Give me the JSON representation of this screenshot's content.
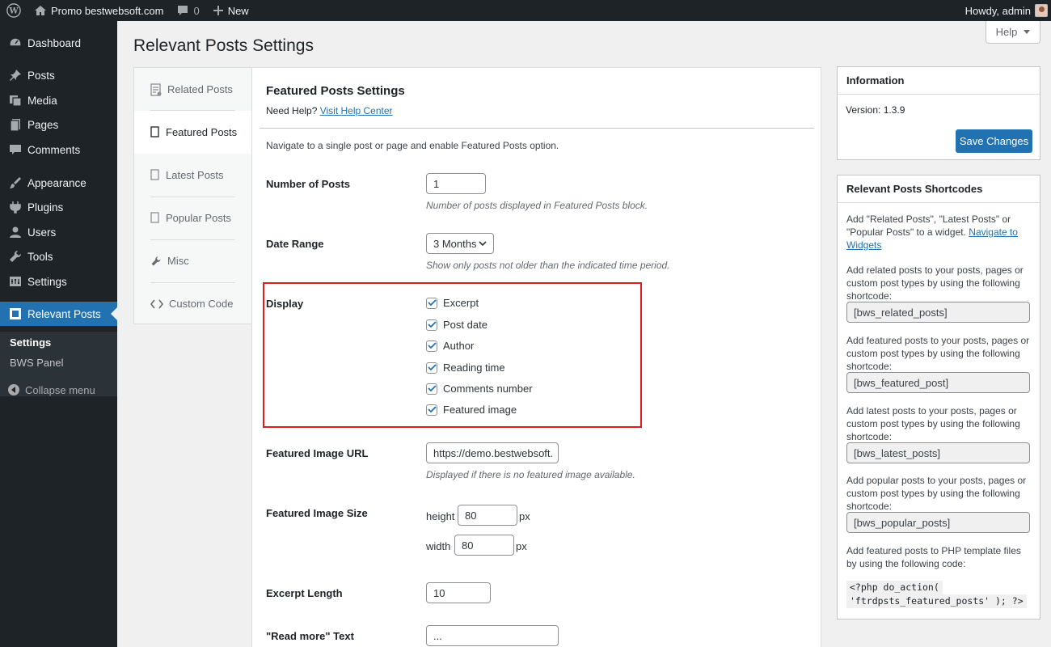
{
  "adminbar": {
    "site": "Promo bestwebsoft.com",
    "comments_count": "0",
    "new_label": "New",
    "howdy": "Howdy, admin"
  },
  "menu": {
    "items": [
      {
        "label": "Dashboard",
        "icon": "dashboard-icon"
      },
      {
        "label": "Posts",
        "icon": "pin-icon"
      },
      {
        "label": "Media",
        "icon": "media-icon"
      },
      {
        "label": "Pages",
        "icon": "pages-icon"
      },
      {
        "label": "Comments",
        "icon": "comments-icon"
      },
      {
        "label": "Appearance",
        "icon": "brush-icon"
      },
      {
        "label": "Plugins",
        "icon": "plugins-icon"
      },
      {
        "label": "Users",
        "icon": "users-icon"
      },
      {
        "label": "Tools",
        "icon": "wrench-icon"
      },
      {
        "label": "Settings",
        "icon": "settings-icon"
      },
      {
        "label": "Relevant Posts",
        "icon": "relevant-posts-icon"
      }
    ],
    "submenu": [
      "Settings",
      "BWS Panel"
    ],
    "collapse": "Collapse menu"
  },
  "help_label": "Help",
  "page_title": "Relevant Posts Settings",
  "tabs": [
    "Related Posts",
    "Featured Posts",
    "Latest Posts",
    "Popular Posts",
    "Misc",
    "Custom Code"
  ],
  "panel": {
    "title": "Featured Posts Settings",
    "need_help": "Need Help?",
    "help_link": "Visit Help Center",
    "intro": "Navigate to a single post or page and enable Featured Posts option.",
    "number_label": "Number of Posts",
    "number_value": "1",
    "number_desc": "Number of posts displayed in Featured Posts block.",
    "date_label": "Date Range",
    "date_value": "3 Months",
    "date_desc": "Show only posts not older than the indicated time period.",
    "display_label": "Display",
    "display_options": [
      "Excerpt",
      "Post date",
      "Author",
      "Reading time",
      "Comments number",
      "Featured image"
    ],
    "image_url_label": "Featured Image URL",
    "image_url_value": "https://demo.bestwebsoft.",
    "image_url_desc": "Displayed if there is no featured image available.",
    "image_size_label": "Featured Image Size",
    "height_label": "height",
    "height_value": "80",
    "width_label": "width",
    "width_value": "80",
    "px": "px",
    "excerpt_label": "Excerpt Length",
    "excerpt_value": "10",
    "readmore_label": "\"Read more\" Text",
    "readmore_value": "..."
  },
  "info": {
    "title": "Information",
    "version": "Version: 1.3.9",
    "save": "Save Changes"
  },
  "shortcodes": {
    "title": "Relevant Posts Shortcodes",
    "widget_text": "Add \"Related Posts\", \"Latest Posts\" or \"Popular Posts\" to a widget.",
    "widget_link": "Navigate to Widgets",
    "related_text": "Add related posts to your posts, pages or custom post types by using the following shortcode:",
    "related_code": "[bws_related_posts]",
    "featured_text": "Add featured posts to your posts, pages or custom post types by using the following shortcode:",
    "featured_code": "[bws_featured_post]",
    "latest_text": "Add latest posts to your posts, pages or custom post types by using the following shortcode:",
    "latest_code": "[bws_latest_posts]",
    "popular_text": "Add popular posts to your posts, pages or custom post types by using the following shortcode:",
    "popular_code": "[bws_popular_posts]",
    "php_text": "Add featured posts to PHP template files by using the following code:",
    "php_code_1": "<?php do_action(",
    "php_code_2": "'ftrdpsts_featured_posts' ); ?>"
  },
  "colors": {
    "accent": "#2271b1",
    "highlight": "#e01b1b",
    "sidebar": "#1d2327"
  }
}
